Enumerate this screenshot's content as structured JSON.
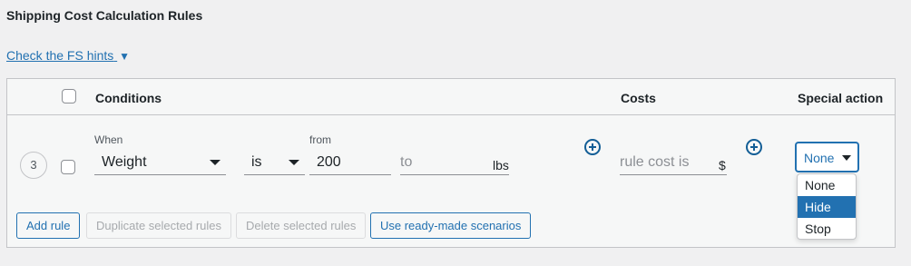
{
  "section": {
    "title": "Shipping Cost Calculation Rules",
    "hints_link": "Check the FS hints",
    "hints_toggle_glyph": "▼"
  },
  "table": {
    "headers": {
      "conditions": "Conditions",
      "costs": "Costs",
      "special_action": "Special action"
    },
    "row": {
      "number": "3",
      "when_label": "When",
      "condition_field": "Weight",
      "operator": "is",
      "from_label": "from",
      "from_value": "200",
      "to_placeholder": "to",
      "weight_unit": "lbs",
      "cost_placeholder": "rule cost is",
      "currency": "$",
      "special_action_value": "None"
    },
    "special_action_options": [
      "None",
      "Hide",
      "Stop"
    ],
    "special_action_highlighted": "Hide"
  },
  "buttons": {
    "add_rule": "Add rule",
    "duplicate": "Duplicate selected rules",
    "delete": "Delete selected rules",
    "scenarios": "Use ready-made scenarios"
  },
  "colors": {
    "accent": "#2271b1",
    "dark_accent": "#135e96",
    "background": "#f0f0f1",
    "table_bg": "#f6f7f7",
    "border": "#c3c4c7",
    "disabled": "#a7aaad"
  },
  "icons": {
    "add_condition": "plus-circle-icon",
    "add_cost": "plus-circle-icon",
    "dropdown_caret": "caret-down-icon"
  }
}
